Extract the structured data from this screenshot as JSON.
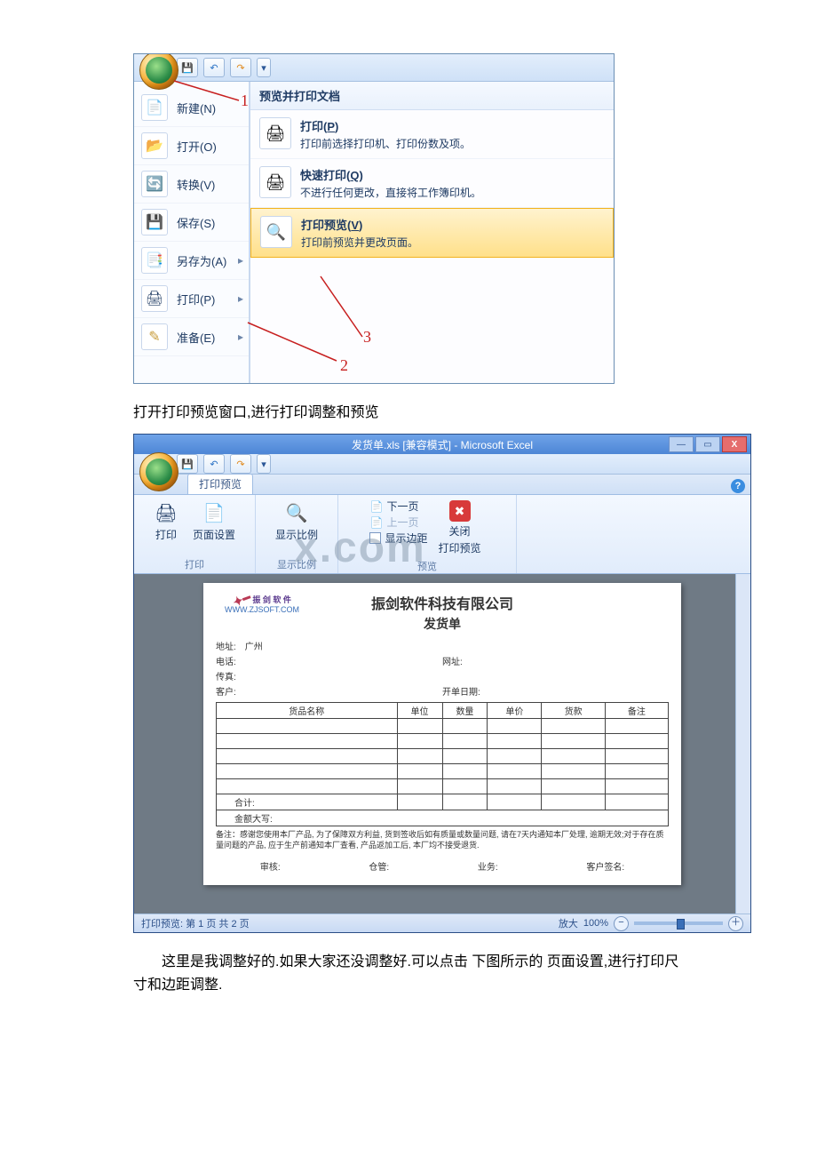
{
  "screenshot1": {
    "qat": {
      "save": "💾",
      "undo": "↶",
      "redo": "↷",
      "more": "▾"
    },
    "left_menu": [
      {
        "icon": "📄",
        "label": "新建(N)",
        "sub": false
      },
      {
        "icon": "📂",
        "label": "打开(O)",
        "sub": false
      },
      {
        "icon": "🔄",
        "label": "转换(V)",
        "sub": false
      },
      {
        "icon": "💾",
        "label": "保存(S)",
        "sub": false
      },
      {
        "icon": "📑",
        "label": "另存为(A)",
        "sub": true
      },
      {
        "icon": "🖨",
        "label": "打印(P)",
        "sub": true
      },
      {
        "icon": "✎",
        "label": "准备(E)",
        "sub": true
      }
    ],
    "right_header": "预览并打印文档",
    "right_items": [
      {
        "icon": "🖨",
        "title_pre": "打印(",
        "title_u": "P",
        "title_post": ")",
        "desc": "打印前选择打印机、打印份数及项。",
        "hl": false
      },
      {
        "icon": "🖨",
        "title_pre": "快速打印(",
        "title_u": "Q",
        "title_post": ")",
        "desc": "不进行任何更改，直接将工作簿印机。",
        "hl": false
      },
      {
        "icon": "🔍",
        "title_pre": "打印预览(",
        "title_u": "V",
        "title_post": ")",
        "desc": "打印前预览并更改页面。",
        "hl": true
      }
    ],
    "annotations": {
      "n1": "1",
      "n2": "2",
      "n3": "3"
    }
  },
  "caption1": "打开打印预览窗口,进行打印调整和预览",
  "screenshot2": {
    "title": "发货单.xls [兼容模式] - Microsoft Excel",
    "tab": "打印预览",
    "help": "?",
    "ribbon": {
      "g1": {
        "btn1": "打印",
        "btn2": "页面设置",
        "name": "打印"
      },
      "g2": {
        "btn": "显示比例",
        "name": "显示比例"
      },
      "g3": {
        "next": "下一页",
        "prev": "上一页",
        "margins": "显示边距",
        "close_btn": "✖",
        "close_lbl": "关闭",
        "close_lbl2": "打印预览",
        "name": "预览"
      }
    },
    "watermark": "x.com",
    "paper": {
      "brand1": "振 剑 软 件",
      "brand2": "WWW.ZJSOFT.COM",
      "title": "振剑软件科技有限公司",
      "subtitle": "发货单",
      "addr_l": "地址:",
      "addr_v": "广州",
      "tel_l": "电话:",
      "fax_l": "传真:",
      "cust_l": "客户:",
      "web_l": "网址:",
      "date_l": "开单日期:",
      "headers": [
        "货品名称",
        "单位",
        "数量",
        "单价",
        "货款",
        "备注"
      ],
      "sum": "合计:",
      "caps": "金额大写:",
      "note": "备注：感谢您使用本厂产品, 为了保障双方利益, 货到签收后如有质量或数量问题, 请在7天内通知本厂处理, 逾期无效;对于存在质量问题的产品, 应于生产前通知本厂查看, 产品返加工后, 本厂均不接受退货.",
      "审核": "审核:",
      "仓管": "仓管:",
      "业务": "业务:",
      "签名": "客户签名:"
    },
    "status_left": "打印预览: 第 1 页  共 2 页",
    "status_zoom_l": "放大",
    "status_zoom_v": "100%"
  },
  "body_text": "这里是我调整好的.如果大家还没调整好.可以点击 下图所示的 页面设置,进行打印尺寸和边距调整."
}
